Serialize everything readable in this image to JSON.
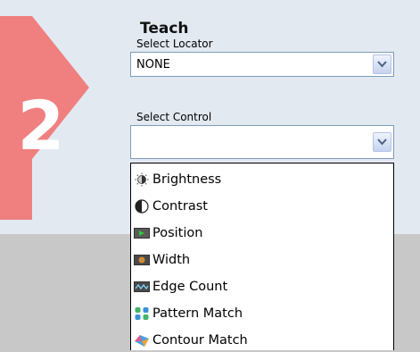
{
  "step": {
    "number": "2"
  },
  "teach": {
    "title": "Teach",
    "locator": {
      "label": "Select Locator",
      "value": "NONE"
    },
    "control": {
      "label": "Select Control",
      "value": "",
      "options": [
        {
          "label": "Brightness",
          "icon": "brightness-icon"
        },
        {
          "label": "Contrast",
          "icon": "contrast-icon"
        },
        {
          "label": "Position",
          "icon": "position-icon"
        },
        {
          "label": "Width",
          "icon": "width-icon"
        },
        {
          "label": "Edge Count",
          "icon": "edge-count-icon"
        },
        {
          "label": "Pattern Match",
          "icon": "pattern-match-icon"
        },
        {
          "label": "Contour Match",
          "icon": "contour-match-icon"
        }
      ]
    }
  },
  "colors": {
    "panel": "#e3e9f1",
    "badge": "#f08080",
    "background": "#c8c8c8"
  }
}
